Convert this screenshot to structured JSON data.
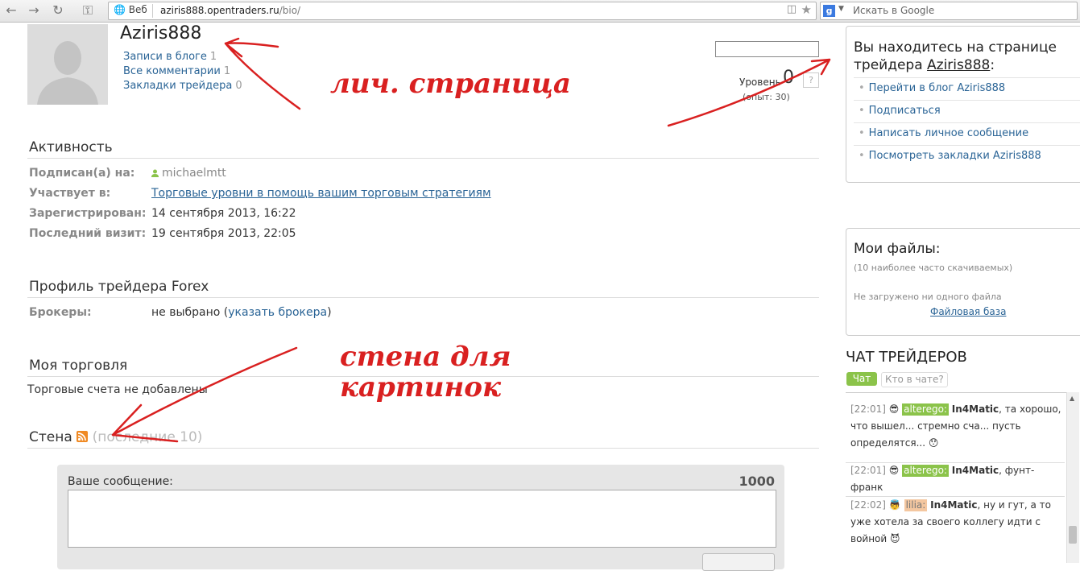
{
  "browser": {
    "url_prefix": "Веб",
    "url_host": "aziris888.opentraders.ru",
    "url_path": "/bio/",
    "search_placeholder": "Искать в Google"
  },
  "profile": {
    "username": "Aziris888",
    "links": [
      {
        "label": "Записи в блоге",
        "count": "1"
      },
      {
        "label": "Все комментарии",
        "count": "1"
      },
      {
        "label": "Закладки трейдера",
        "count": "0"
      }
    ],
    "level_label": "Уровень",
    "level_value": "0",
    "level_help": "?",
    "experience": "(опыт: 30)"
  },
  "activity": {
    "title": "Активность",
    "rows": [
      {
        "label": "Подписан(а) на:",
        "value": "michaelmtt"
      },
      {
        "label": "Участвует в:",
        "value": "Торговые уровни в помощь вашим торговым стратегиям"
      },
      {
        "label": "Зарегистрирован:",
        "value": "14 сентября 2013, 16:22"
      },
      {
        "label": "Последний визит:",
        "value": "19 сентября 2013, 22:05"
      }
    ]
  },
  "forex": {
    "title": "Профиль трейдера Forex",
    "broker_label": "Брокеры:",
    "broker_value": "не выбрано",
    "broker_link": "указать брокера"
  },
  "trading": {
    "title": "Моя торговля",
    "text": "Торговые счета не добавлены"
  },
  "wall": {
    "title": "Стена",
    "subtitle": "(последние 10)",
    "message_label": "Ваше сообщение:",
    "char_limit": "1000"
  },
  "sidebar": {
    "youhere_title": "Вы находитесь на странице трейдера",
    "youhere_user": "Aziris888",
    "actions": [
      "Перейти в блог Aziris888",
      "Подписаться",
      "Написать личное сообщение",
      "Посмотреть закладки Aziris888"
    ],
    "files_title": "Мои файлы:",
    "files_sub": "(10 наиболее часто скачиваемых)",
    "files_none": "Не загружено ни одного файла",
    "files_link": "Файловая база"
  },
  "chat": {
    "title": "ЧАТ ТРЕЙДЕРОВ",
    "tab_active": "Чат",
    "tab_who": "Кто в чате?",
    "messages": [
      {
        "time": "[22:01]",
        "user": "alterego:",
        "to": "In4Matic",
        "text": ", та хорошо, что вышел... стремно сча... пусть определятся..."
      },
      {
        "time": "[22:01]",
        "user": "alterego:",
        "to": "In4Matic",
        "text": ", фунт-франк"
      },
      {
        "time": "[22:02]",
        "user": "lilia:",
        "to": "In4Matic",
        "text": ", ну и гут, а то уже хотела за своего коллегу идти с войной"
      }
    ]
  },
  "annotations": {
    "personal_page": "лич. страница",
    "wall_line1": "стена для",
    "wall_line2": "картинок"
  },
  "colors": {
    "link": "#2a6496",
    "annotation": "#d92020",
    "chat_tab": "#8bc34a"
  }
}
